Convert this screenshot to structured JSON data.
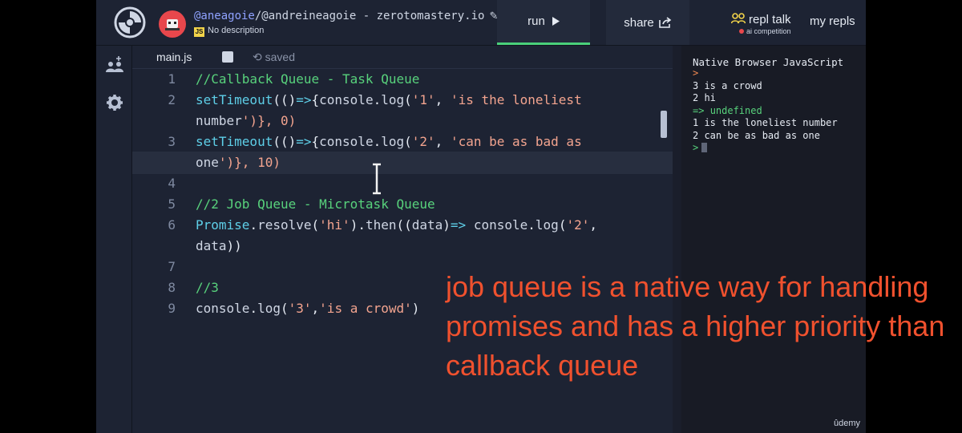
{
  "header": {
    "user_link": "@aneagoie",
    "repl_path": "/@andreineagoie - zerotomastery.io",
    "description": "No description",
    "lang_badge": "JS",
    "run_label": "run",
    "share_label": "share",
    "repl_talk_label": "repl talk",
    "repl_talk_sub": "ai competition",
    "my_repls_label": "my repls"
  },
  "sidebar": {
    "icons": [
      "users-icon",
      "gear-icon"
    ]
  },
  "filebar": {
    "file_name": "main.js",
    "status": "saved"
  },
  "editor": {
    "lines": [
      {
        "n": "1",
        "text": "//Callback Queue - Task Queue"
      },
      {
        "n": "2",
        "text": "setTimeout(()=>{console.log('1', 'is the loneliest"
      },
      {
        "n": "",
        "text": "number')}, 0)"
      },
      {
        "n": "3",
        "text": "setTimeout(()=>{console.log('2', 'can be as bad as"
      },
      {
        "n": "",
        "text": "one')}, 10)"
      },
      {
        "n": "4",
        "text": ""
      },
      {
        "n": "5",
        "text": "//2 Job Queue - Microtask Queue"
      },
      {
        "n": "6",
        "text": "Promise.resolve('hi').then((data)=> console.log('2',"
      },
      {
        "n": "",
        "text": "data))"
      },
      {
        "n": "7",
        "text": ""
      },
      {
        "n": "8",
        "text": "//3"
      },
      {
        "n": "9",
        "text": "console.log('3','is a crowd')"
      }
    ]
  },
  "console": {
    "title": "Native Browser JavaScript",
    "prompt1": ">",
    "out1": "3 is a crowd",
    "out2": "2 hi",
    "arrow": "=>",
    "undefined_text": "undefined",
    "out3": "1 is the loneliest number",
    "out4": "2 can be as bad as one",
    "prompt2": ">"
  },
  "watermark": "ûdemy",
  "caption": "job queue is a native way for handling promises and has a higher priority than callback queue",
  "colors": {
    "accent_run": "#4ad07a",
    "comment": "#58d27c",
    "string": "#f3a48f",
    "caption": "#f0512e"
  }
}
